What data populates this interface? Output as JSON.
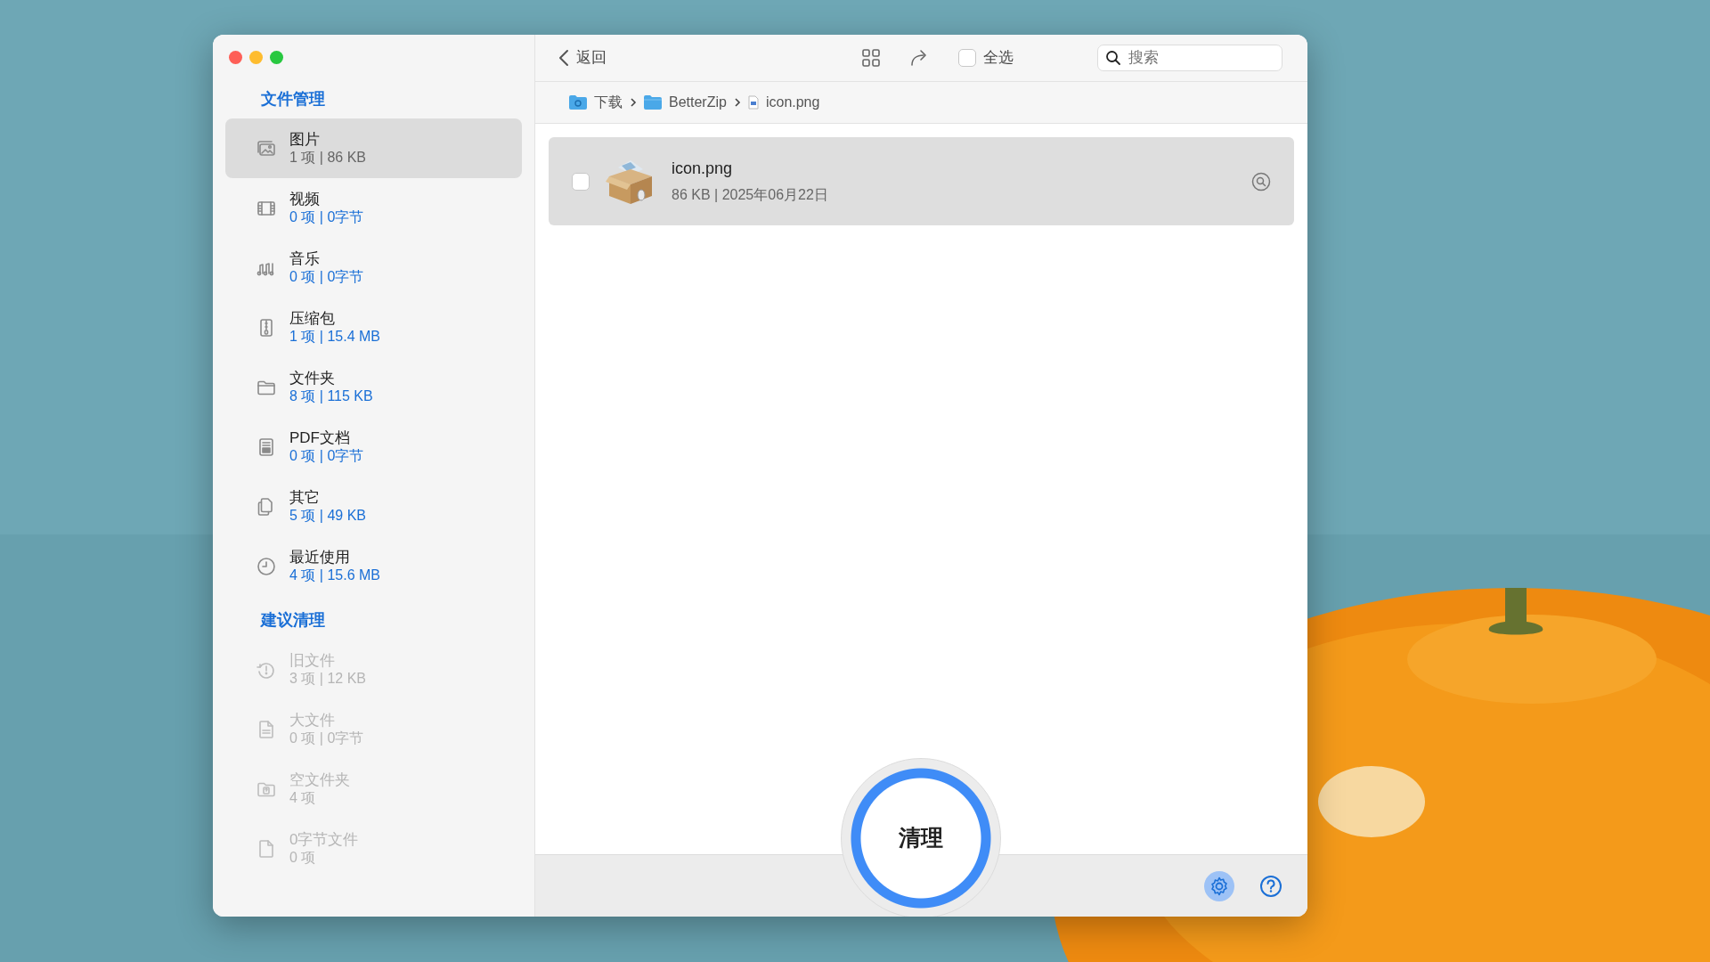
{
  "sidebar": {
    "sections": [
      {
        "title": "文件管理",
        "items": [
          {
            "kind": "images",
            "name": "图片",
            "stats": "1 项 | 86 KB",
            "selected": true,
            "disabled": false
          },
          {
            "kind": "video",
            "name": "视频",
            "stats": "0 项 | 0字节",
            "selected": false,
            "disabled": false
          },
          {
            "kind": "music",
            "name": "音乐",
            "stats": "0 项 | 0字节",
            "selected": false,
            "disabled": false
          },
          {
            "kind": "archive",
            "name": "压缩包",
            "stats": "1 项 | 15.4 MB",
            "selected": false,
            "disabled": false
          },
          {
            "kind": "folder",
            "name": "文件夹",
            "stats": "8 项 | 115 KB",
            "selected": false,
            "disabled": false
          },
          {
            "kind": "pdf",
            "name": "PDF文档",
            "stats": "0 项 | 0字节",
            "selected": false,
            "disabled": false
          },
          {
            "kind": "other",
            "name": "其它",
            "stats": "5 项 | 49 KB",
            "selected": false,
            "disabled": false
          },
          {
            "kind": "recent",
            "name": "最近使用",
            "stats": "4 项 | 15.6 MB",
            "selected": false,
            "disabled": false
          }
        ]
      },
      {
        "title": "建议清理",
        "items": [
          {
            "kind": "old",
            "name": "旧文件",
            "stats": "3 项 | 12 KB",
            "selected": false,
            "disabled": true
          },
          {
            "kind": "large",
            "name": "大文件",
            "stats": "0 项 | 0字节",
            "selected": false,
            "disabled": true
          },
          {
            "kind": "empty-folder",
            "name": "空文件夹",
            "stats": "4 项",
            "selected": false,
            "disabled": true
          },
          {
            "kind": "zero-file",
            "name": "0字节文件",
            "stats": "0 项",
            "selected": false,
            "disabled": true
          }
        ]
      }
    ]
  },
  "toolbar": {
    "back": "返回",
    "select_all": {
      "label": "全选",
      "checked": false
    },
    "search": {
      "placeholder": "搜索"
    }
  },
  "breadcrumb": [
    {
      "kind": "download-folder",
      "label": "下载"
    },
    {
      "kind": "folder",
      "label": "BetterZip"
    },
    {
      "kind": "file",
      "label": "icon.png"
    }
  ],
  "files": [
    {
      "name": "icon.png",
      "meta": "86 KB | 2025年06月22日",
      "checked": false
    }
  ],
  "clean_button": "清理"
}
